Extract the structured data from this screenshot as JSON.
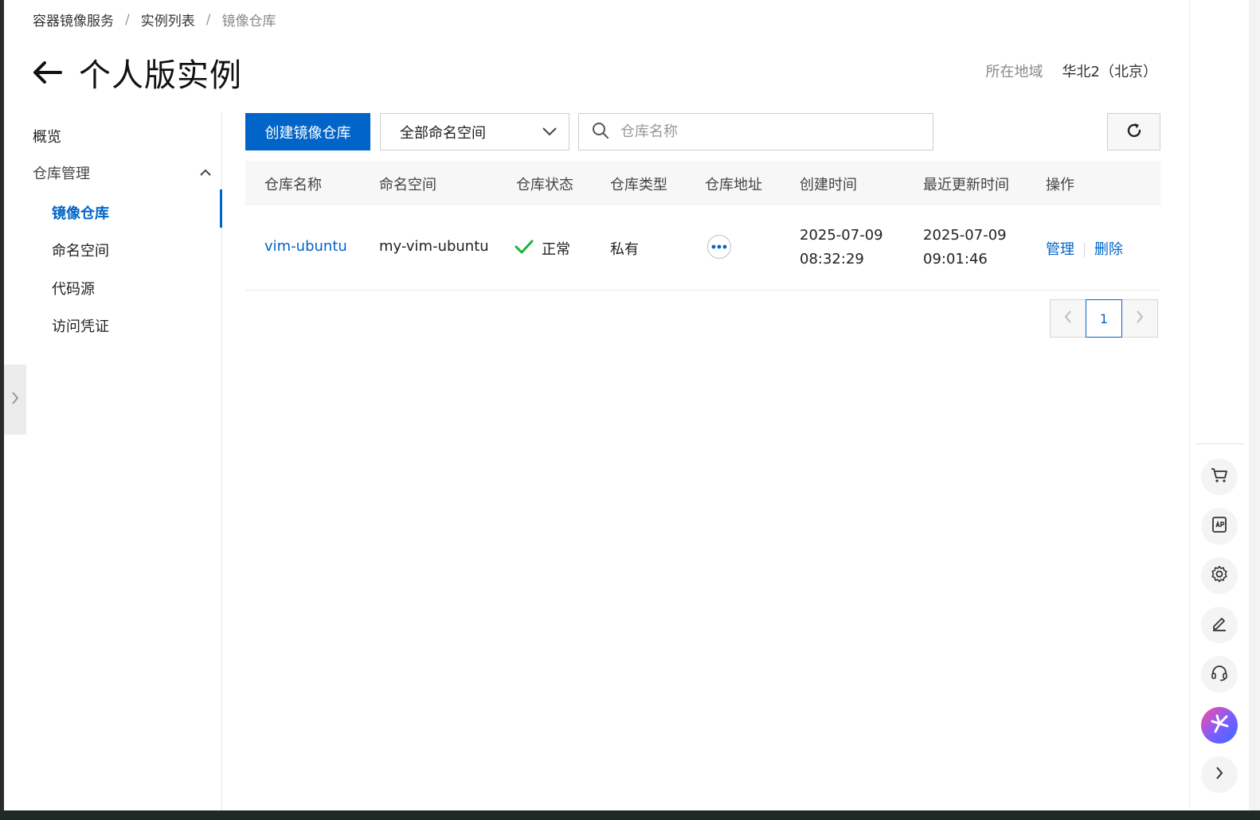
{
  "breadcrumb": [
    "容器镜像服务",
    "实例列表",
    "镜像仓库"
  ],
  "breadcrumb_separator": "/",
  "title": "个人版实例",
  "region": {
    "label": "所在地域",
    "value": "华北2（北京）"
  },
  "nav": {
    "overview": "概览",
    "group": "仓库管理",
    "items": [
      "镜像仓库",
      "命名空间",
      "代码源",
      "访问凭证"
    ]
  },
  "toolbar": {
    "create_button": "创建镜像仓库",
    "namespace_select": "全部命名空间",
    "search_placeholder": "仓库名称"
  },
  "table": {
    "columns": [
      "仓库名称",
      "命名空间",
      "仓库状态",
      "仓库类型",
      "仓库地址",
      "创建时间",
      "最近更新时间",
      "操作"
    ],
    "rows": [
      {
        "name": "vim-ubuntu",
        "namespace": "my-vim-ubuntu",
        "status": "正常",
        "type": "私有",
        "created_date": "2025-07-09",
        "created_time": "08:32:29",
        "updated_date": "2025-07-09",
        "updated_time": "09:01:46",
        "actions": [
          "管理",
          "删除"
        ]
      }
    ]
  },
  "pagination": {
    "current": "1"
  },
  "colors": {
    "primary": "#0064c8",
    "success": "#1ab33c"
  },
  "rail_icons": [
    "cart-icon",
    "api-icon",
    "settings-icon",
    "edit-icon",
    "support-icon",
    "ai-assistant-icon",
    "expand-icon"
  ]
}
